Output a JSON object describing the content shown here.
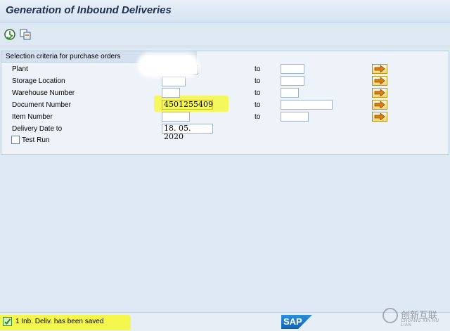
{
  "window": {
    "title": "Generation of Inbound Deliveries"
  },
  "toolbar": {
    "buttons": [
      {
        "icon": "execute-clock-icon"
      },
      {
        "icon": "variant-copy-icon"
      }
    ]
  },
  "selection": {
    "header": "Selection criteria for purchase orders",
    "to_label": "to",
    "rows": [
      {
        "label": "Plant",
        "from": "",
        "to": ""
      },
      {
        "label": "Storage Location",
        "from": "",
        "to": ""
      },
      {
        "label": "Warehouse Number",
        "from": "",
        "to": ""
      },
      {
        "label": "Document Number",
        "from": "4501255409",
        "to": ""
      },
      {
        "label": "Item Number",
        "from": "",
        "to": ""
      },
      {
        "label": "Delivery Date to",
        "from": "18. 05. 2020"
      }
    ],
    "test_run_label": "Test Run"
  },
  "status": {
    "message": "1 Inb. Deliv. has been saved",
    "type": "success"
  },
  "branding": {
    "sap_logo": "SAP",
    "watermark_cn": "创新互联",
    "watermark_en": "CHUANG XIN HU LIAN"
  },
  "colors": {
    "highlight": "#f5f74d",
    "title": "#1c2f4e",
    "background": "#dfe9f4"
  }
}
